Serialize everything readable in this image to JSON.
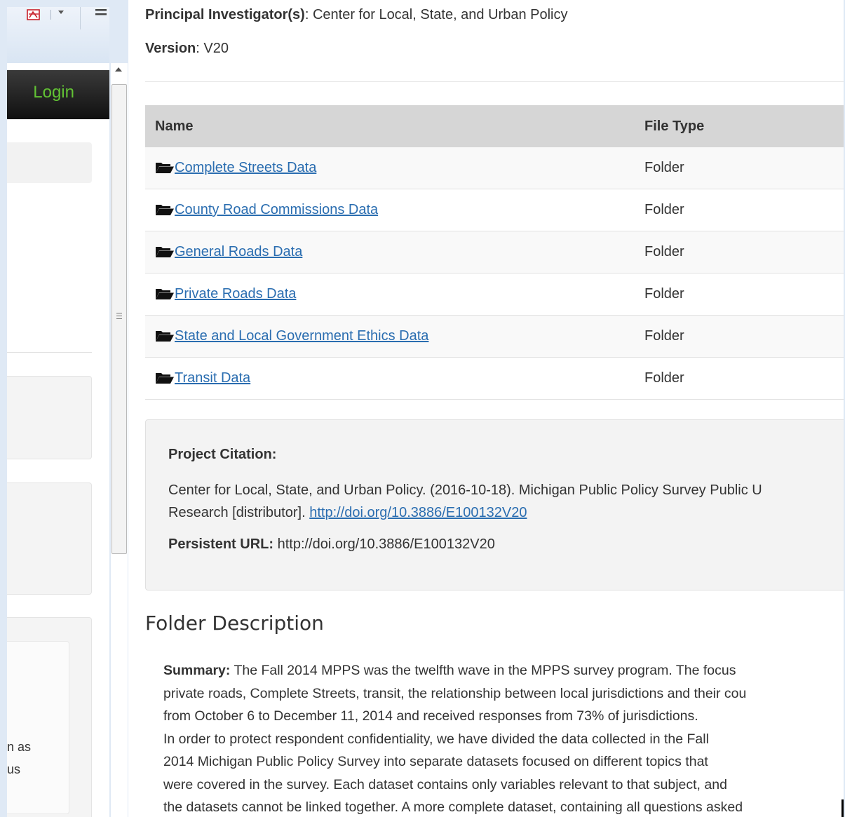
{
  "left_panel": {
    "login_label": "Login",
    "fragments": [
      "n as",
      "us"
    ]
  },
  "meta": {
    "pi_label": "Principal Investigator(s)",
    "pi_value": ":  Center for Local, State, and Urban Policy",
    "version_label": "Version",
    "version_value": ": V20"
  },
  "table": {
    "headers": [
      "Name",
      "File Type"
    ],
    "rows": [
      {
        "name": "Complete Streets Data",
        "type": "Folder"
      },
      {
        "name": "County Road Commissions Data",
        "type": "Folder"
      },
      {
        "name": "General Roads Data",
        "type": "Folder"
      },
      {
        "name": "Private Roads Data",
        "type": "Folder"
      },
      {
        "name": "State and Local Government Ethics Data",
        "type": "Folder"
      },
      {
        "name": "Transit Data",
        "type": "Folder"
      }
    ]
  },
  "citation": {
    "heading": "Project Citation:",
    "text_line1": "Center for Local, State, and Urban Policy. (2016-10-18). Michigan Public Policy Survey Public U",
    "text_line2_prefix": "Research [distributor]. ",
    "doi_link": "http://doi.org/10.3886/E100132V20",
    "persistent_label": "Persistent URL:",
    "persistent_value": " http://doi.org/10.3886/E100132V20"
  },
  "description": {
    "heading": "Folder Description",
    "summary_label": "Summary:",
    "summary_line1": "  The Fall 2014 MPPS was the twelfth wave in the MPPS survey program. The focus",
    "lines": [
      "private roads, Complete Streets, transit, the relationship between local jurisdictions and their cou",
      "from October 6 to December 11, 2014 and received responses from 73% of jurisdictions.",
      "In order to protect respondent confidentiality, we have divided the data collected in the Fall",
      "2014 Michigan Public Policy Survey into separate datasets focused on different topics that",
      "were covered in the survey. Each dataset contains only variables relevant to that subject, and",
      "the datasets cannot be linked together. A more complete dataset, containing all questions asked"
    ]
  },
  "colors": {
    "link": "#2a6db0",
    "login": "#62c234",
    "header_bg": "#d6d6d6"
  }
}
